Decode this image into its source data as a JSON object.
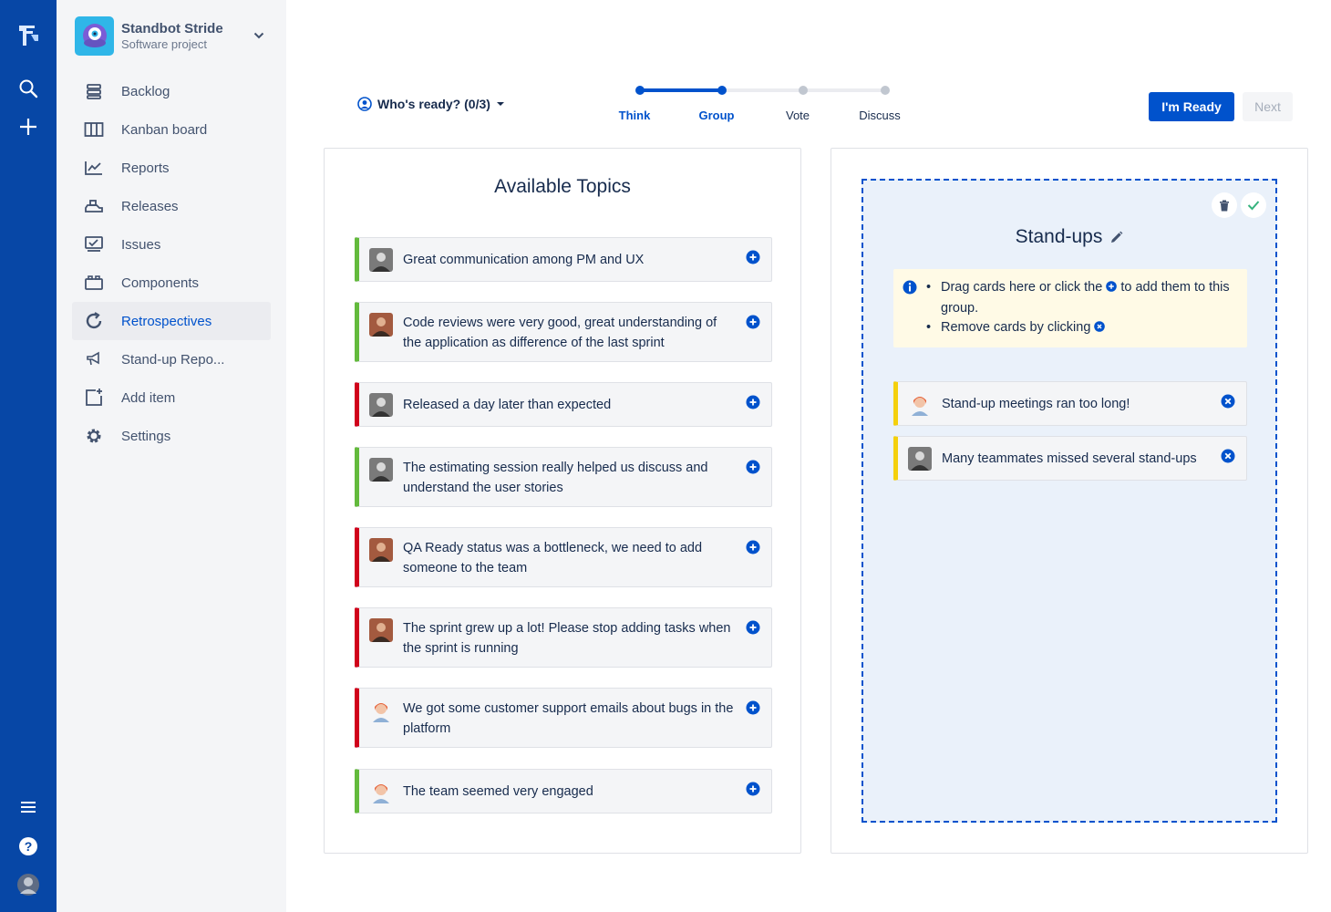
{
  "project": {
    "name": "Standbot Stride",
    "type": "Software project"
  },
  "sidebar": {
    "items": [
      {
        "label": "Backlog",
        "icon": "backlog-icon"
      },
      {
        "label": "Kanban board",
        "icon": "kanban-board-icon"
      },
      {
        "label": "Reports",
        "icon": "reports-icon"
      },
      {
        "label": "Releases",
        "icon": "releases-icon"
      },
      {
        "label": "Issues",
        "icon": "issues-icon"
      },
      {
        "label": "Components",
        "icon": "components-icon"
      },
      {
        "label": "Retrospectives",
        "icon": "retrospectives-icon",
        "active": true
      },
      {
        "label": "Stand-up Repo...",
        "icon": "megaphone-icon"
      },
      {
        "label": "Add item",
        "icon": "add-item-icon"
      },
      {
        "label": "Settings",
        "icon": "gear-icon"
      }
    ]
  },
  "toolbar": {
    "ready_label": "Who's ready? (0/3)",
    "ready_button": "I'm Ready",
    "next_button": "Next"
  },
  "steps": [
    {
      "label": "Think",
      "done": true
    },
    {
      "label": "Group",
      "done": true
    },
    {
      "label": "Vote",
      "done": false
    },
    {
      "label": "Discuss",
      "done": false
    }
  ],
  "available": {
    "title": "Available Topics",
    "cards": [
      {
        "text": "Great communication among PM and UX",
        "color": "green"
      },
      {
        "text": "Code reviews were very good, great understanding of the application as difference of the last sprint",
        "color": "green"
      },
      {
        "text": "Released a day later than expected",
        "color": "red"
      },
      {
        "text": "The estimating session really helped us discuss and understand the user stories",
        "color": "green"
      },
      {
        "text": "QA Ready status was a bottleneck, we need to add someone to the team",
        "color": "red"
      },
      {
        "text": "The sprint grew up a lot! Please stop adding tasks when the sprint is running",
        "color": "red"
      },
      {
        "text": "We got some customer support emails about bugs in the platform",
        "color": "red"
      },
      {
        "text": "The team seemed very engaged",
        "color": "green"
      }
    ]
  },
  "group": {
    "title": "Stand-ups",
    "info_line1": "Drag cards here or click the",
    "info_line1b": "to add them to this group.",
    "info_line2": "Remove cards by clicking",
    "cards": [
      {
        "text": "Stand-up meetings ran too long!",
        "color": "yellow"
      },
      {
        "text": "Many teammates missed several stand-ups",
        "color": "yellow"
      }
    ]
  },
  "colors": {
    "accent": "#0052cc",
    "nav": "#0747a6",
    "green": "#63ba3c",
    "red": "#d0021b",
    "yellow": "#f4d00c"
  }
}
